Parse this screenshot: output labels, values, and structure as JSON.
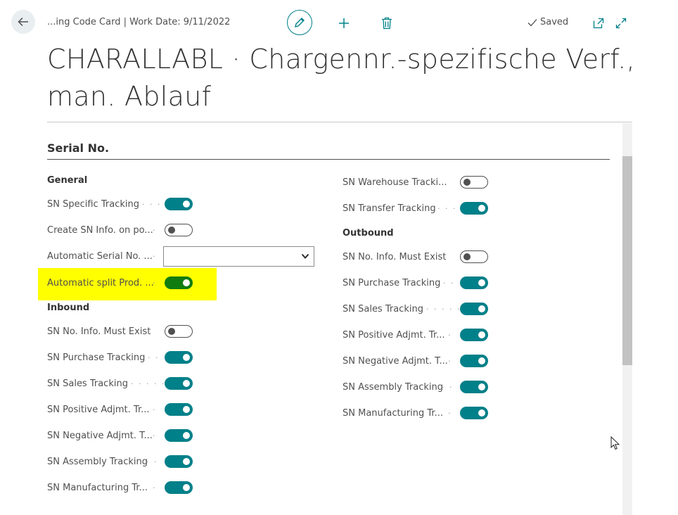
{
  "header": {
    "breadcrumb": "...ing Code Card | Work Date: 9/11/2022",
    "saved_label": "Saved"
  },
  "page_title": "CHARALLABL · Chargennr.-spezifische Verf., man. Ablauf",
  "section": {
    "title": "Serial No."
  },
  "left_column": {
    "general": {
      "title": "General",
      "fields": [
        {
          "label": "SN Specific Tracking",
          "dots": "· · ·",
          "type": "toggle",
          "value": true
        },
        {
          "label": "Create SN Info. on po...",
          "dots": "·",
          "type": "toggle",
          "value": false
        },
        {
          "label": "Automatic Serial No. ...",
          "dots": "·",
          "type": "select",
          "value": ""
        },
        {
          "label": "Automatic split Prod. ...",
          "dots": "·",
          "type": "toggle",
          "value": true,
          "highlighted": true
        }
      ]
    },
    "inbound": {
      "title": "Inbound",
      "fields": [
        {
          "label": "SN No. Info. Must Exist",
          "dots": "",
          "type": "toggle",
          "value": false
        },
        {
          "label": "SN Purchase Tracking",
          "dots": "· ·",
          "type": "toggle",
          "value": true
        },
        {
          "label": "SN Sales Tracking",
          "dots": "· · · · ·",
          "type": "toggle",
          "value": true
        },
        {
          "label": "SN Positive Adjmt. Tr...",
          "dots": "·",
          "type": "toggle",
          "value": true
        },
        {
          "label": "SN Negative Adjmt. T...",
          "dots": "·",
          "type": "toggle",
          "value": true
        },
        {
          "label": "SN Assembly Tracking",
          "dots": "· ·",
          "type": "toggle",
          "value": true
        },
        {
          "label": "SN Manufacturing Tr...",
          "dots": "·",
          "type": "toggle",
          "value": true
        }
      ]
    }
  },
  "right_column": {
    "top_fields": [
      {
        "label": "SN Warehouse Tracki...",
        "dots": "",
        "type": "toggle",
        "value": false
      },
      {
        "label": "SN Transfer Tracking",
        "dots": "· · ·",
        "type": "toggle",
        "value": true
      }
    ],
    "outbound": {
      "title": "Outbound",
      "fields": [
        {
          "label": "SN No. Info. Must Exist",
          "dots": "",
          "type": "toggle",
          "value": false
        },
        {
          "label": "SN Purchase Tracking",
          "dots": "· ·",
          "type": "toggle",
          "value": true
        },
        {
          "label": "SN Sales Tracking",
          "dots": "· · · · ·",
          "type": "toggle",
          "value": true
        },
        {
          "label": "SN Positive Adjmt. Tr...",
          "dots": "·",
          "type": "toggle",
          "value": true
        },
        {
          "label": "SN Negative Adjmt. T...",
          "dots": "·",
          "type": "toggle",
          "value": true
        },
        {
          "label": "SN Assembly Tracking",
          "dots": "· ·",
          "type": "toggle",
          "value": true
        },
        {
          "label": "SN Manufacturing Tr...",
          "dots": "·",
          "type": "toggle",
          "value": true
        }
      ]
    }
  },
  "colors": {
    "accent": "#008089",
    "toggle_highlight": "#107c10",
    "highlight_bg": "#ffff00"
  },
  "icons": [
    "arrow-left-icon",
    "pencil-icon",
    "plus-icon",
    "trash-icon",
    "checkmark-icon",
    "popout-icon",
    "expand-icon"
  ]
}
